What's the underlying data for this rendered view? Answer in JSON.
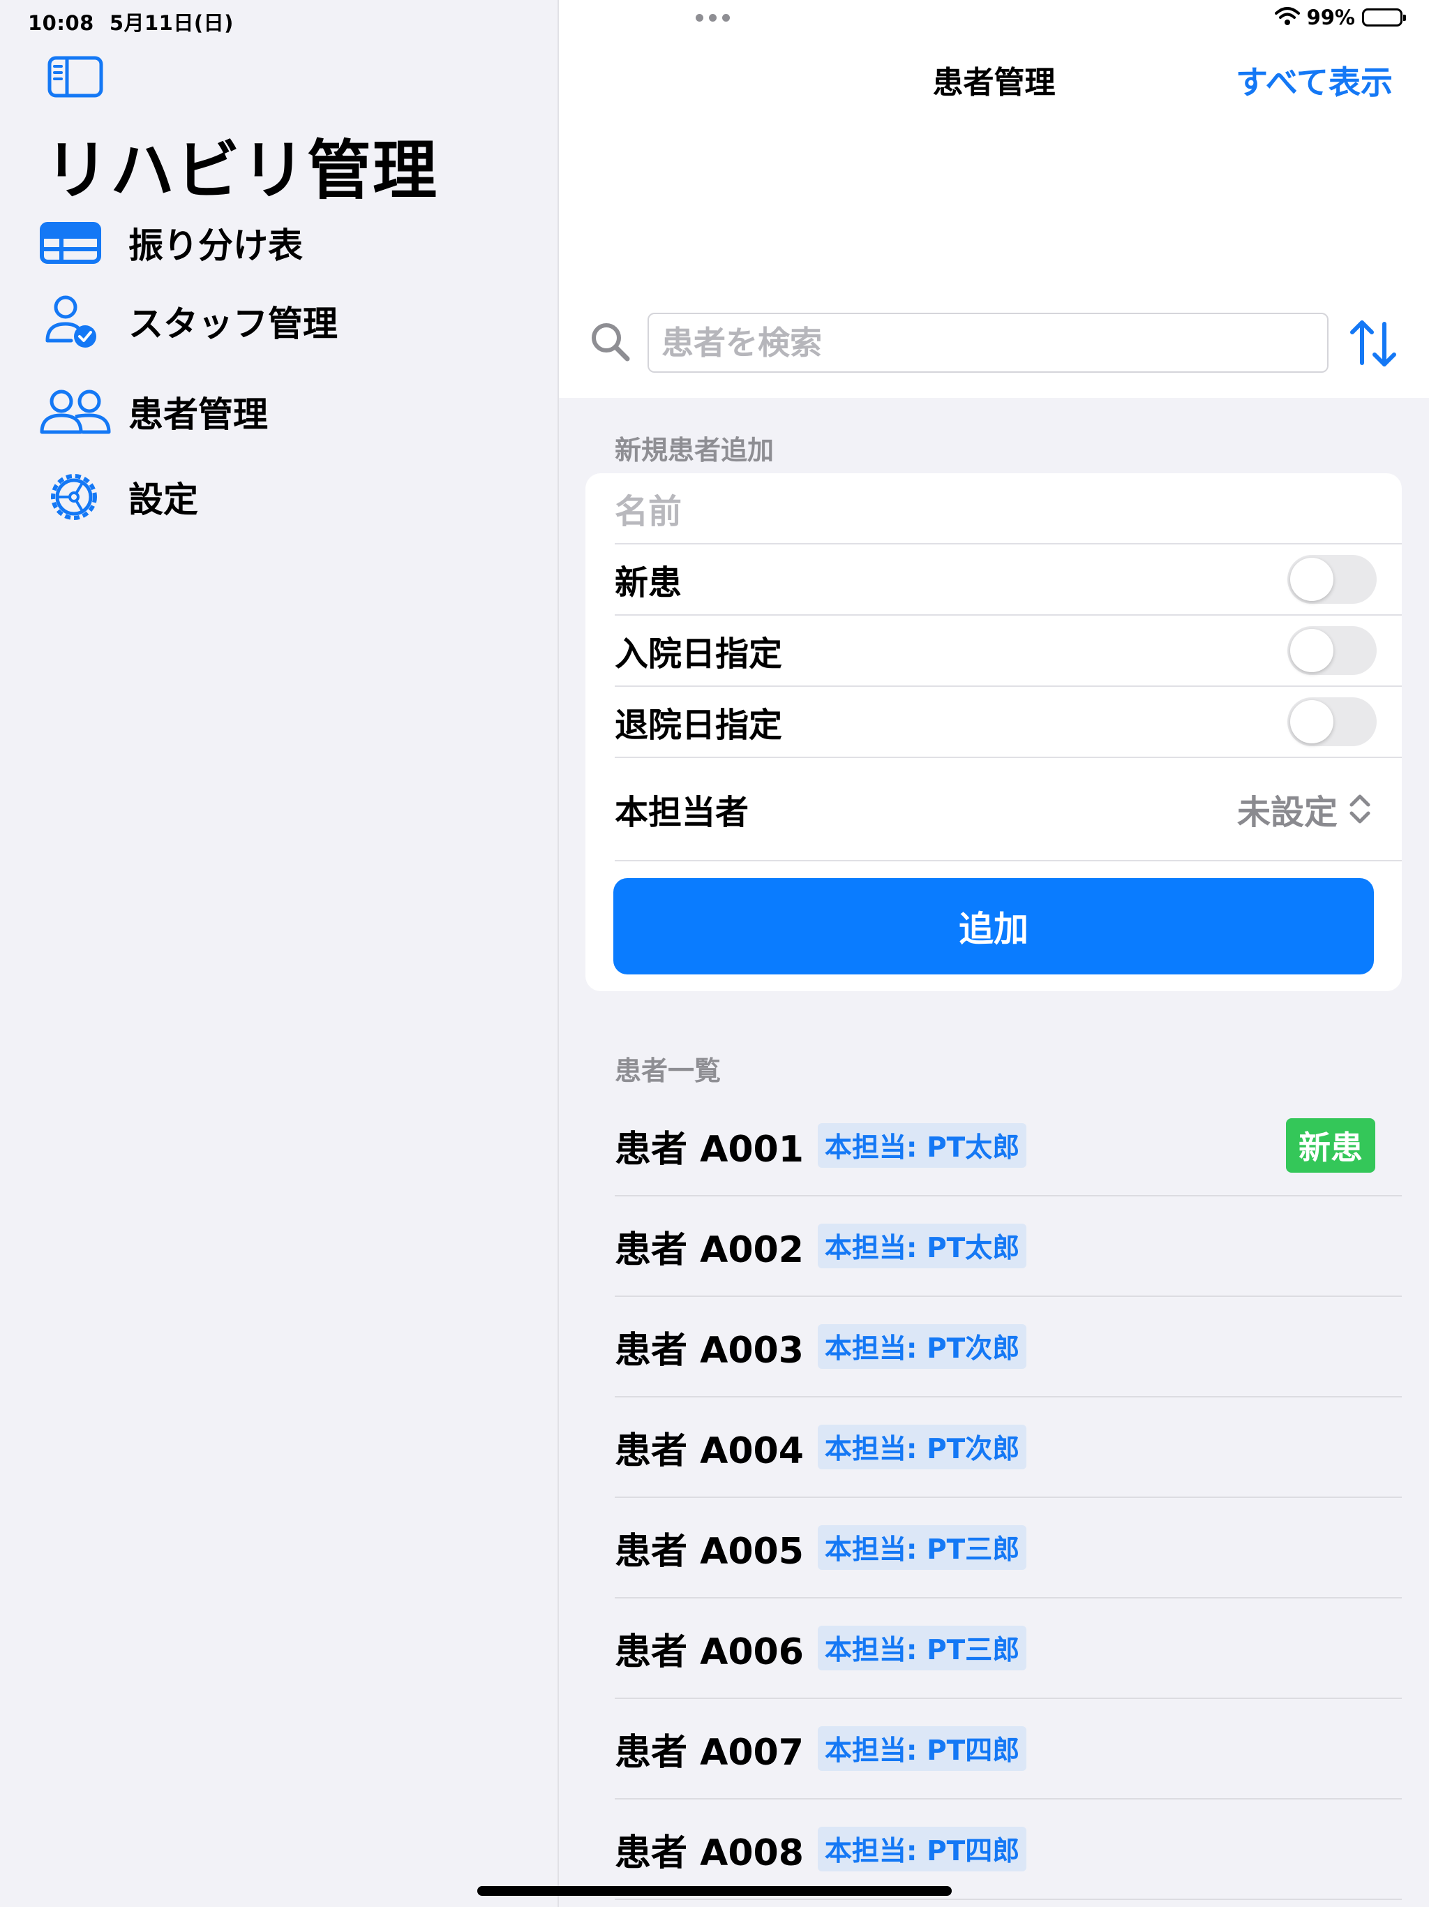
{
  "status_bar": {
    "time": "10:08",
    "date": "5月11日(日)",
    "battery_text": "99%",
    "battery_level": 0.99
  },
  "sidebar": {
    "toggle_icon": "sidebar-toggle-icon",
    "title": "リハビリ管理",
    "items": [
      {
        "label": "振り分け表",
        "icon": "table-icon"
      },
      {
        "label": "スタッフ管理",
        "icon": "person-check-icon"
      },
      {
        "label": "患者管理",
        "icon": "people-icon"
      },
      {
        "label": "設定",
        "icon": "gear-icon"
      }
    ]
  },
  "navigation": {
    "title": "患者管理",
    "show_all_label": "すべて表示"
  },
  "search": {
    "placeholder": "患者を検索",
    "value": ""
  },
  "new_patient_form": {
    "section_title": "新規患者追加",
    "name_placeholder": "名前",
    "toggles": [
      {
        "label": "新患",
        "on": false
      },
      {
        "label": "入院日指定",
        "on": false
      },
      {
        "label": "退院日指定",
        "on": false
      }
    ],
    "primary_staff": {
      "label": "本担当者",
      "value": "未設定"
    },
    "add_button_label": "追加"
  },
  "patient_list": {
    "section_title": "患者一覧",
    "patients": [
      {
        "name": "患者 A001",
        "staff": "本担当: PT太郎",
        "badge": "新患"
      },
      {
        "name": "患者 A002",
        "staff": "本担当: PT太郎",
        "badge": ""
      },
      {
        "name": "患者 A003",
        "staff": "本担当: PT次郎",
        "badge": ""
      },
      {
        "name": "患者 A004",
        "staff": "本担当: PT次郎",
        "badge": ""
      },
      {
        "name": "患者 A005",
        "staff": "本担当: PT三郎",
        "badge": ""
      },
      {
        "name": "患者 A006",
        "staff": "本担当: PT三郎",
        "badge": ""
      },
      {
        "name": "患者 A007",
        "staff": "本担当: PT四郎",
        "badge": ""
      },
      {
        "name": "患者 A008",
        "staff": "本担当: PT四郎",
        "badge": ""
      }
    ]
  },
  "colors": {
    "accent": "#0A7CFF",
    "link": "#1478F5",
    "new_badge": "#34C759",
    "background": "#F2F2F7"
  }
}
